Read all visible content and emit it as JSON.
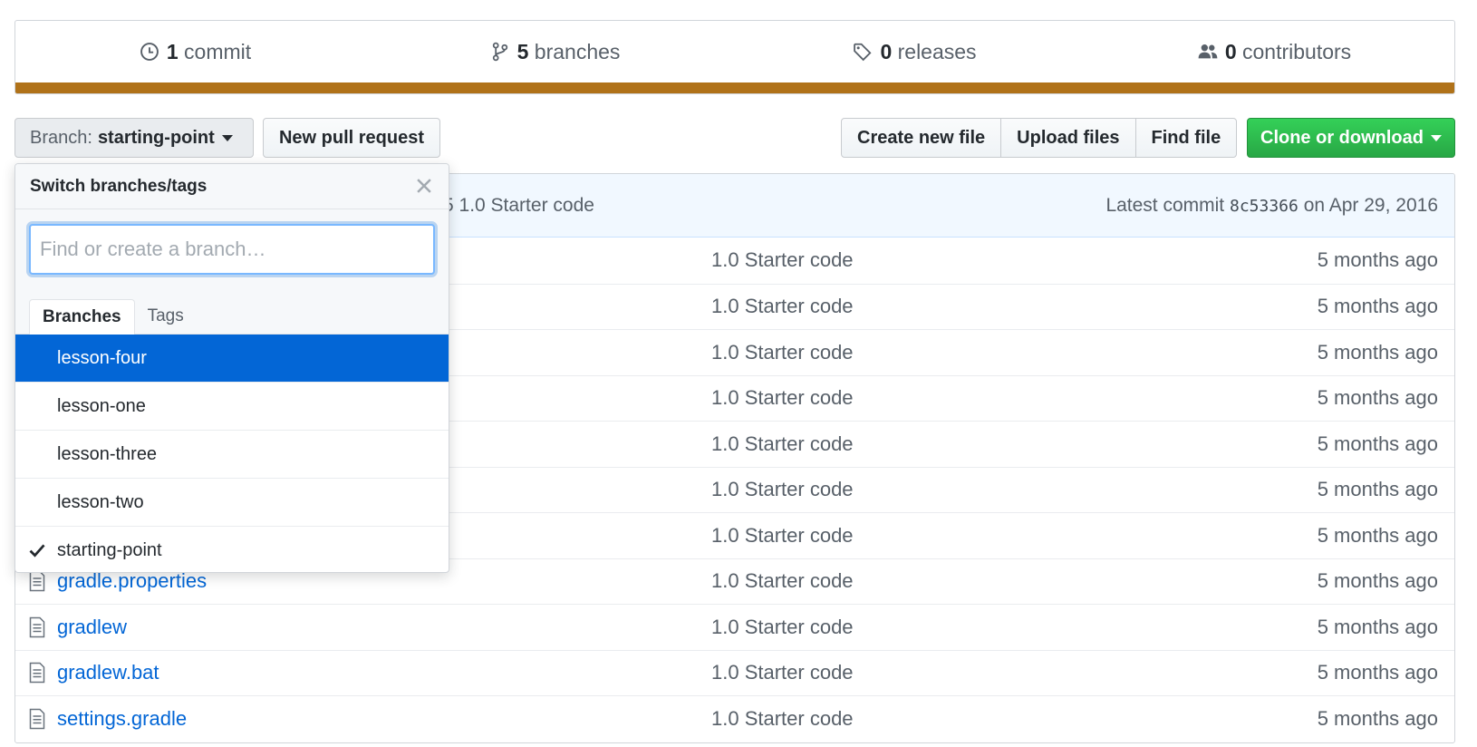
{
  "summary": {
    "commits_count": "1",
    "commits_label": "commit",
    "branches_count": "5",
    "branches_label": "branches",
    "releases_count": "0",
    "releases_label": "releases",
    "contributors_count": "0",
    "contributors_label": "contributors",
    "language_color": "#b07219"
  },
  "toolbar": {
    "branch_prefix": "Branch:",
    "branch_name": "starting-point",
    "new_pr": "New pull request",
    "create_file": "Create new file",
    "upload_files": "Upload files",
    "find_file": "Find file",
    "clone": "Clone or download",
    "clone_color": "#28a745"
  },
  "commit_tease": {
    "message": "5 1.0 Starter code",
    "latest_label": "Latest commit",
    "sha": "8c53366",
    "date": "on Apr 29, 2016"
  },
  "files": [
    {
      "name": "",
      "message": "1.0 Starter code",
      "age": "5 months ago"
    },
    {
      "name": "",
      "message": "1.0 Starter code",
      "age": "5 months ago"
    },
    {
      "name": "",
      "message": "1.0 Starter code",
      "age": "5 months ago"
    },
    {
      "name": "",
      "message": "1.0 Starter code",
      "age": "5 months ago"
    },
    {
      "name": "",
      "message": "1.0 Starter code",
      "age": "5 months ago"
    },
    {
      "name": "",
      "message": "1.0 Starter code",
      "age": "5 months ago"
    },
    {
      "name": "",
      "message": "1.0 Starter code",
      "age": "5 months ago"
    },
    {
      "name": "gradle.properties",
      "message": "1.0 Starter code",
      "age": "5 months ago"
    },
    {
      "name": "gradlew",
      "message": "1.0 Starter code",
      "age": "5 months ago"
    },
    {
      "name": "gradlew.bat",
      "message": "1.0 Starter code",
      "age": "5 months ago"
    },
    {
      "name": "settings.gradle",
      "message": "1.0 Starter code",
      "age": "5 months ago"
    }
  ],
  "dropdown": {
    "title": "Switch branches/tags",
    "placeholder": "Find or create a branch…",
    "tab_branches": "Branches",
    "tab_tags": "Tags",
    "branches": [
      {
        "name": "lesson-four",
        "selected": true,
        "current": false
      },
      {
        "name": "lesson-one",
        "selected": false,
        "current": false
      },
      {
        "name": "lesson-three",
        "selected": false,
        "current": false
      },
      {
        "name": "lesson-two",
        "selected": false,
        "current": false
      },
      {
        "name": "starting-point",
        "selected": false,
        "current": true
      }
    ]
  }
}
